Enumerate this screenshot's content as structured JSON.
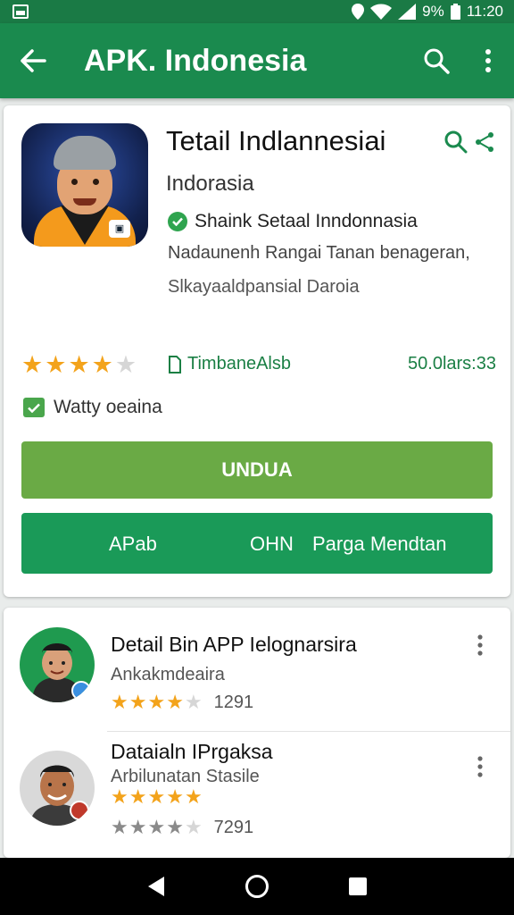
{
  "status_bar": {
    "battery_text": "9%",
    "time": "11:20"
  },
  "app_bar": {
    "title": "APK. Indonesia"
  },
  "app": {
    "name": "Tetail Indlannesiai",
    "publisher": "Indorasia",
    "verified_text": "Shaink Setaal Inndonnasia",
    "description_line1": "Nadaunenh Rangai Tanan benageran,",
    "description_line2": "Slkayaaldpansial Daroia",
    "rating": 4,
    "max_rating": 5,
    "size_label": "TimbaneAlsb",
    "downloads": "50.0lars:33",
    "safe_label": "Watty oeaina"
  },
  "buttons": {
    "download": "UNDUA",
    "left": "APab",
    "middle": "OHN",
    "right": "Parga Mendtan"
  },
  "list": [
    {
      "title": "Detail Bin APP Ielognarsira",
      "subtitle": "Ankakmdeaira",
      "rating": 4,
      "count": "1291"
    },
    {
      "title": "Dataialn IPrgaksa",
      "subtitle": "Arbilunatan Stasile",
      "rating": 5,
      "second_rating": 4,
      "count": "7291"
    }
  ],
  "colors": {
    "primary": "#1a8a4e",
    "status": "#1a7a45",
    "download": "#6aaa45",
    "star": "#f3a31b"
  },
  "icons": [
    "image-icon",
    "wifi-icon",
    "signal-icon",
    "battery-icon",
    "back-arrow-icon",
    "search-icon",
    "more-vert-icon",
    "zoom-icon",
    "share-icon",
    "check-icon",
    "download-icon",
    "home-icon",
    "recents-icon"
  ]
}
